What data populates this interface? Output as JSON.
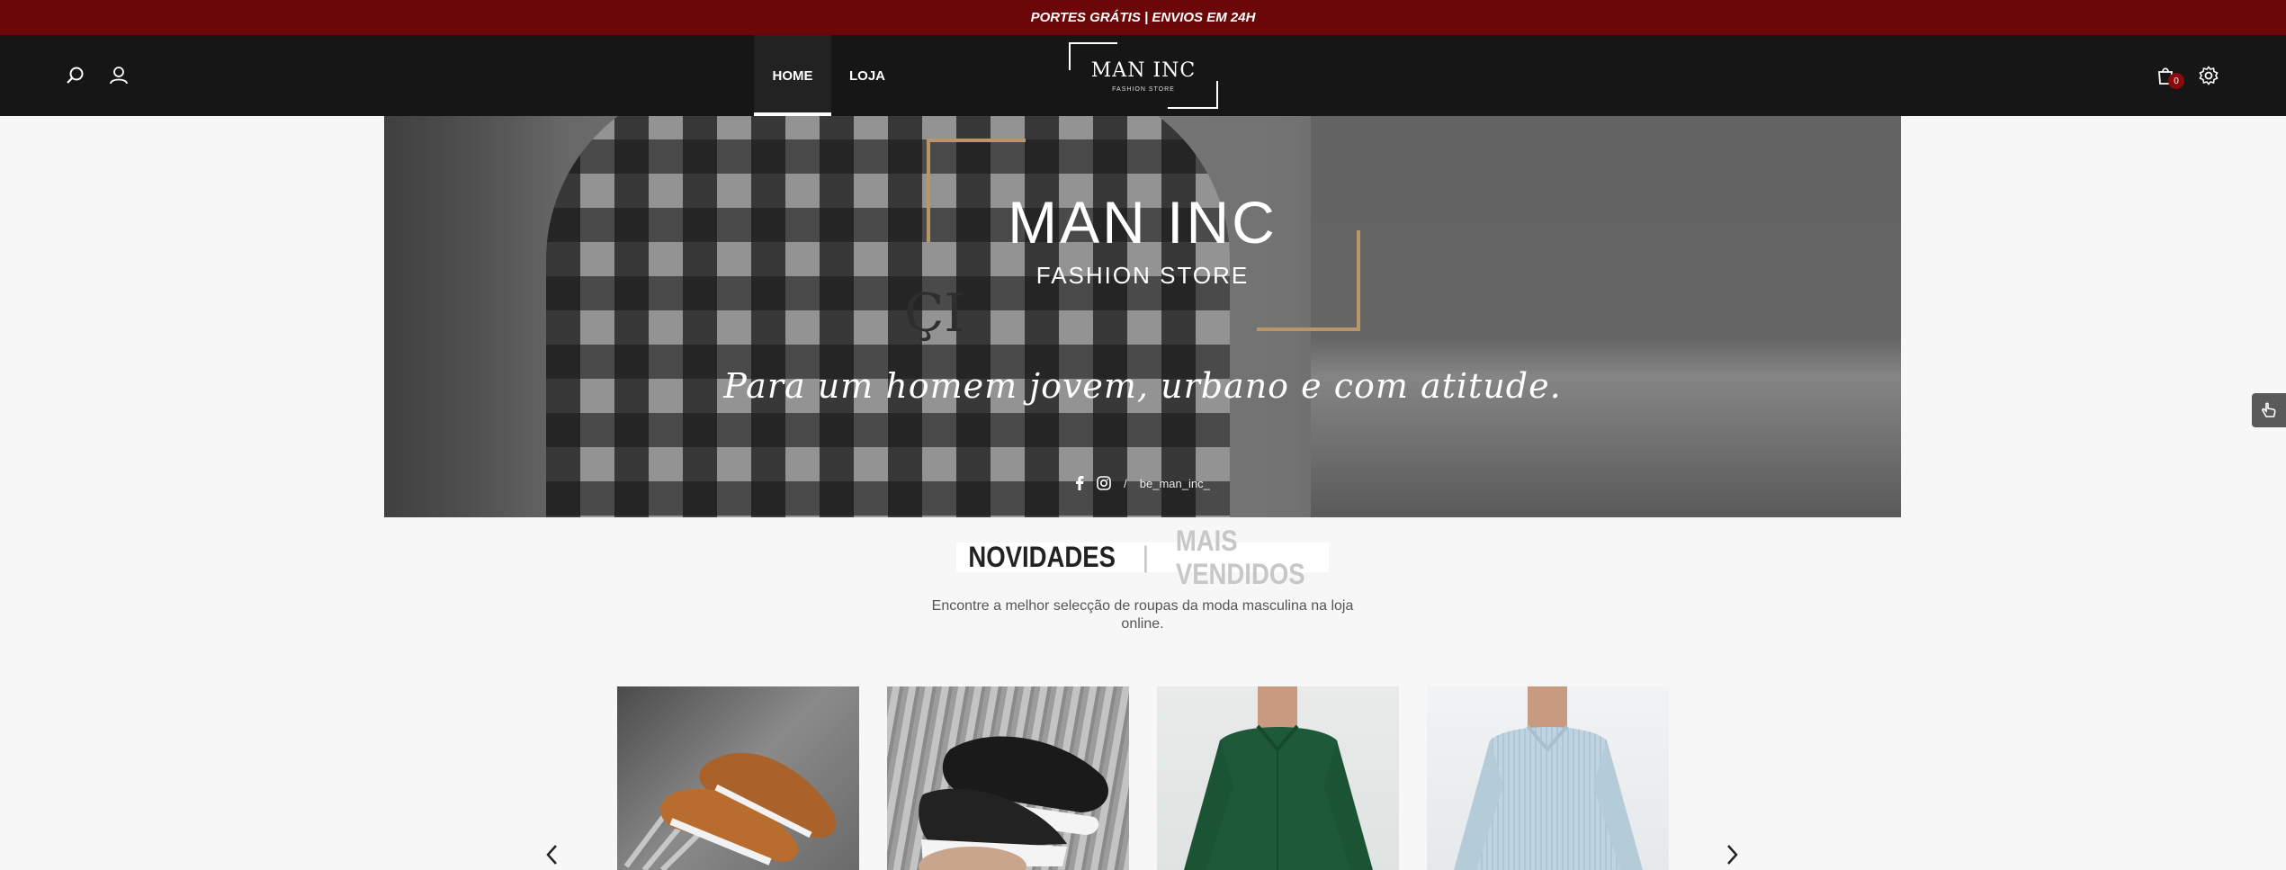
{
  "topbar": {
    "promo_text": "PORTES GRÁTIS | ENVIOS EM 24H"
  },
  "header": {
    "nav": [
      {
        "label": "HOME"
      },
      {
        "label": "LOJA"
      }
    ],
    "logo": {
      "name": "MAN INC",
      "subtitle": "FASHION STORE"
    },
    "cart_count": "0"
  },
  "hero": {
    "title": "MAN INC",
    "subtitle": "FASHION STORE",
    "tagline": "Para um homem jovem, urbano e com atitude.",
    "social_separator": "/",
    "social_handle": "be_man_inc_"
  },
  "section": {
    "tabs": [
      {
        "label": "NOVIDADES"
      },
      {
        "label": "MAIS VENDIDOS"
      }
    ],
    "tab_separator": "|",
    "intro_text": "Encontre a melhor selecção de roupas da moda masculina na loja online."
  },
  "products": [
    {
      "name": "loafers-brown-suede"
    },
    {
      "name": "sneakers-black-white"
    },
    {
      "name": "shirt-green"
    },
    {
      "name": "shirt-light-blue-striped"
    }
  ],
  "colors": {
    "topbar_bg": "#6b0708",
    "header_bg": "#161616",
    "accent_gold": "#b8966a",
    "badge": "#8a0a0a"
  }
}
